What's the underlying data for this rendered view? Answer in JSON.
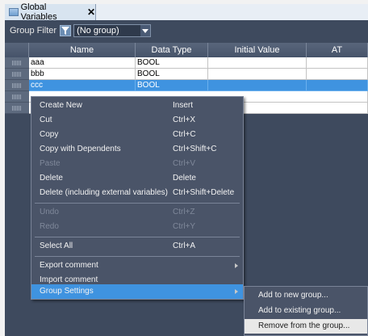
{
  "tab": {
    "title": "Global Variables",
    "close": "✕"
  },
  "filter": {
    "label": "Group Filter",
    "icon": "filter-icon",
    "value": "(No group)"
  },
  "grid": {
    "columns": [
      "Name",
      "Data Type",
      "Initial Value",
      "AT"
    ],
    "rows": [
      {
        "name": "aaa",
        "type": "BOOL",
        "initial": "",
        "at": ""
      },
      {
        "name": "bbb",
        "type": "BOOL",
        "initial": "",
        "at": ""
      },
      {
        "name": "ccc",
        "type": "BOOL",
        "initial": "",
        "at": ""
      }
    ]
  },
  "context_menu": {
    "items": [
      {
        "label": "Create New",
        "shortcut": "Insert"
      },
      {
        "label": "Cut",
        "shortcut": "Ctrl+X"
      },
      {
        "label": "Copy",
        "shortcut": "Ctrl+C"
      },
      {
        "label": "Copy with Dependents",
        "shortcut": "Ctrl+Shift+C"
      },
      {
        "label": "Paste",
        "shortcut": "Ctrl+V"
      },
      {
        "label": "Delete",
        "shortcut": "Delete"
      },
      {
        "label": "Delete (including external variables)",
        "shortcut": "Ctrl+Shift+Delete"
      },
      {
        "label": "Undo",
        "shortcut": "Ctrl+Z"
      },
      {
        "label": "Redo",
        "shortcut": "Ctrl+Y"
      },
      {
        "label": "Select All",
        "shortcut": "Ctrl+A"
      },
      {
        "label": "Export comment",
        "shortcut": ""
      },
      {
        "label": "Import comment",
        "shortcut": ""
      },
      {
        "label": "Group Settings",
        "shortcut": ""
      }
    ]
  },
  "submenu": {
    "items": [
      {
        "label": "Add to new group..."
      },
      {
        "label": "Add to existing group..."
      },
      {
        "label": "Remove from the group..."
      }
    ]
  },
  "colors": {
    "selection": "#3f93e0",
    "panel": "#3e4a5e",
    "menu": "#4a5468"
  }
}
